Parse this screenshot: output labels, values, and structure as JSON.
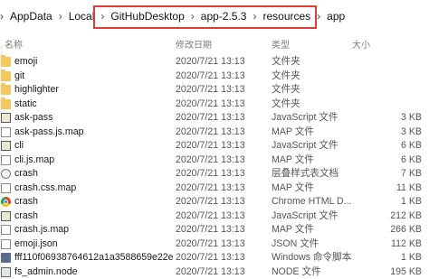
{
  "breadcrumb": {
    "items": [
      "AppData",
      "Local",
      "GitHubDesktop",
      "app-2.5.3",
      "resources",
      "app"
    ],
    "separator": "›"
  },
  "header": {
    "name": "名称",
    "date": "修改日期",
    "type": "类型",
    "size": "大小"
  },
  "files": [
    {
      "name": "emoji",
      "date": "2020/7/21 13:13",
      "type": "文件夹",
      "size": "",
      "icon": "folder-icon"
    },
    {
      "name": "git",
      "date": "2020/7/21 13:13",
      "type": "文件夹",
      "size": "",
      "icon": "folder-icon"
    },
    {
      "name": "highlighter",
      "date": "2020/7/21 13:13",
      "type": "文件夹",
      "size": "",
      "icon": "folder-icon"
    },
    {
      "name": "static",
      "date": "2020/7/21 13:13",
      "type": "文件夹",
      "size": "",
      "icon": "folder-icon"
    },
    {
      "name": "ask-pass",
      "date": "2020/7/21 13:13",
      "type": "JavaScript 文件",
      "size": "3 KB",
      "icon": "script-icon"
    },
    {
      "name": "ask-pass.js.map",
      "date": "2020/7/21 13:13",
      "type": "MAP 文件",
      "size": "3 KB",
      "icon": "file-icon"
    },
    {
      "name": "cli",
      "date": "2020/7/21 13:13",
      "type": "JavaScript 文件",
      "size": "6 KB",
      "icon": "script-icon"
    },
    {
      "name": "cli.js.map",
      "date": "2020/7/21 13:13",
      "type": "MAP 文件",
      "size": "6 KB",
      "icon": "file-icon"
    },
    {
      "name": "crash",
      "date": "2020/7/21 13:13",
      "type": "层叠样式表文档",
      "size": "7 KB",
      "icon": "css-icon"
    },
    {
      "name": "crash.css.map",
      "date": "2020/7/21 13:13",
      "type": "MAP 文件",
      "size": "11 KB",
      "icon": "file-icon"
    },
    {
      "name": "crash",
      "date": "2020/7/21 13:13",
      "type": "Chrome HTML D...",
      "size": "1 KB",
      "icon": "chrome-icon"
    },
    {
      "name": "crash",
      "date": "2020/7/21 13:13",
      "type": "JavaScript 文件",
      "size": "212 KB",
      "icon": "script-icon"
    },
    {
      "name": "crash.js.map",
      "date": "2020/7/21 13:13",
      "type": "MAP 文件",
      "size": "266 KB",
      "icon": "file-icon"
    },
    {
      "name": "emoji.json",
      "date": "2020/7/21 13:13",
      "type": "JSON 文件",
      "size": "112 KB",
      "icon": "file-icon"
    },
    {
      "name": "fff110f06938764612a1a3588659e22e",
      "date": "2020/7/21 13:13",
      "type": "Windows 命令脚本",
      "size": "1 KB",
      "icon": "exe-icon"
    },
    {
      "name": "fs_admin.node",
      "date": "2020/7/21 13:13",
      "type": "NODE 文件",
      "size": "195 KB",
      "icon": "node-icon"
    }
  ]
}
